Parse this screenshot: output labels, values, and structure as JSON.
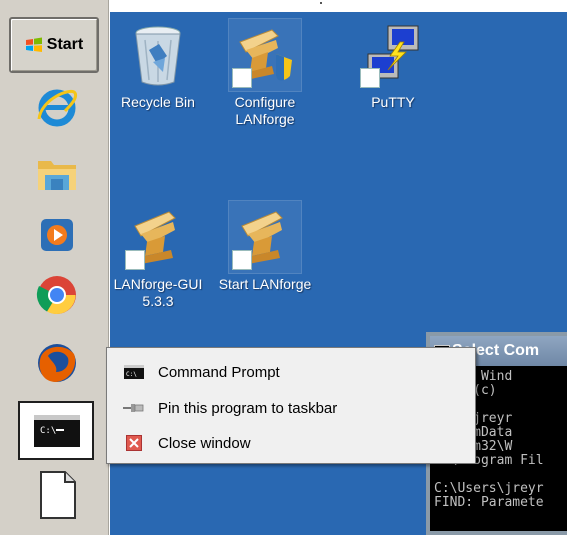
{
  "taskbar": {
    "start_label": "Start",
    "pinned_icons": [
      "internet-explorer-icon",
      "file-explorer-icon",
      "media-player-icon",
      "chrome-icon",
      "firefox-icon",
      "command-prompt-icon",
      "document-icon"
    ]
  },
  "desktop": {
    "icons": [
      {
        "label": "Recycle Bin",
        "icon": "recycle-bin-icon"
      },
      {
        "label": "Configure\nLANforge",
        "icon": "anvil-shield-icon"
      },
      {
        "label": "PuTTY",
        "icon": "putty-icon"
      },
      {
        "label": "LANforge-GUI\n5.3.3",
        "icon": "anvil-icon"
      },
      {
        "label": "Start LANforge",
        "icon": "anvil-icon"
      }
    ]
  },
  "console_window": {
    "title": "Select Com",
    "lines": "osoft Wind\night (c)\n\nsers\\jreyr\nrogramData\nSystem32\\W\nC:\\Program Fil\n\nC:\\Users\\jreyr\nFIND: Paramete"
  },
  "jump_menu": {
    "items": [
      {
        "label": "Command Prompt",
        "icon": "command-prompt-icon"
      },
      {
        "label": "Pin this program to taskbar",
        "icon": "pin-icon"
      },
      {
        "label": "Close window",
        "icon": "close-icon"
      }
    ]
  },
  "colors": {
    "desktop": "#2968b2",
    "taskbar": "#d4d0c8",
    "menu_bg": "#f0f0f0"
  }
}
